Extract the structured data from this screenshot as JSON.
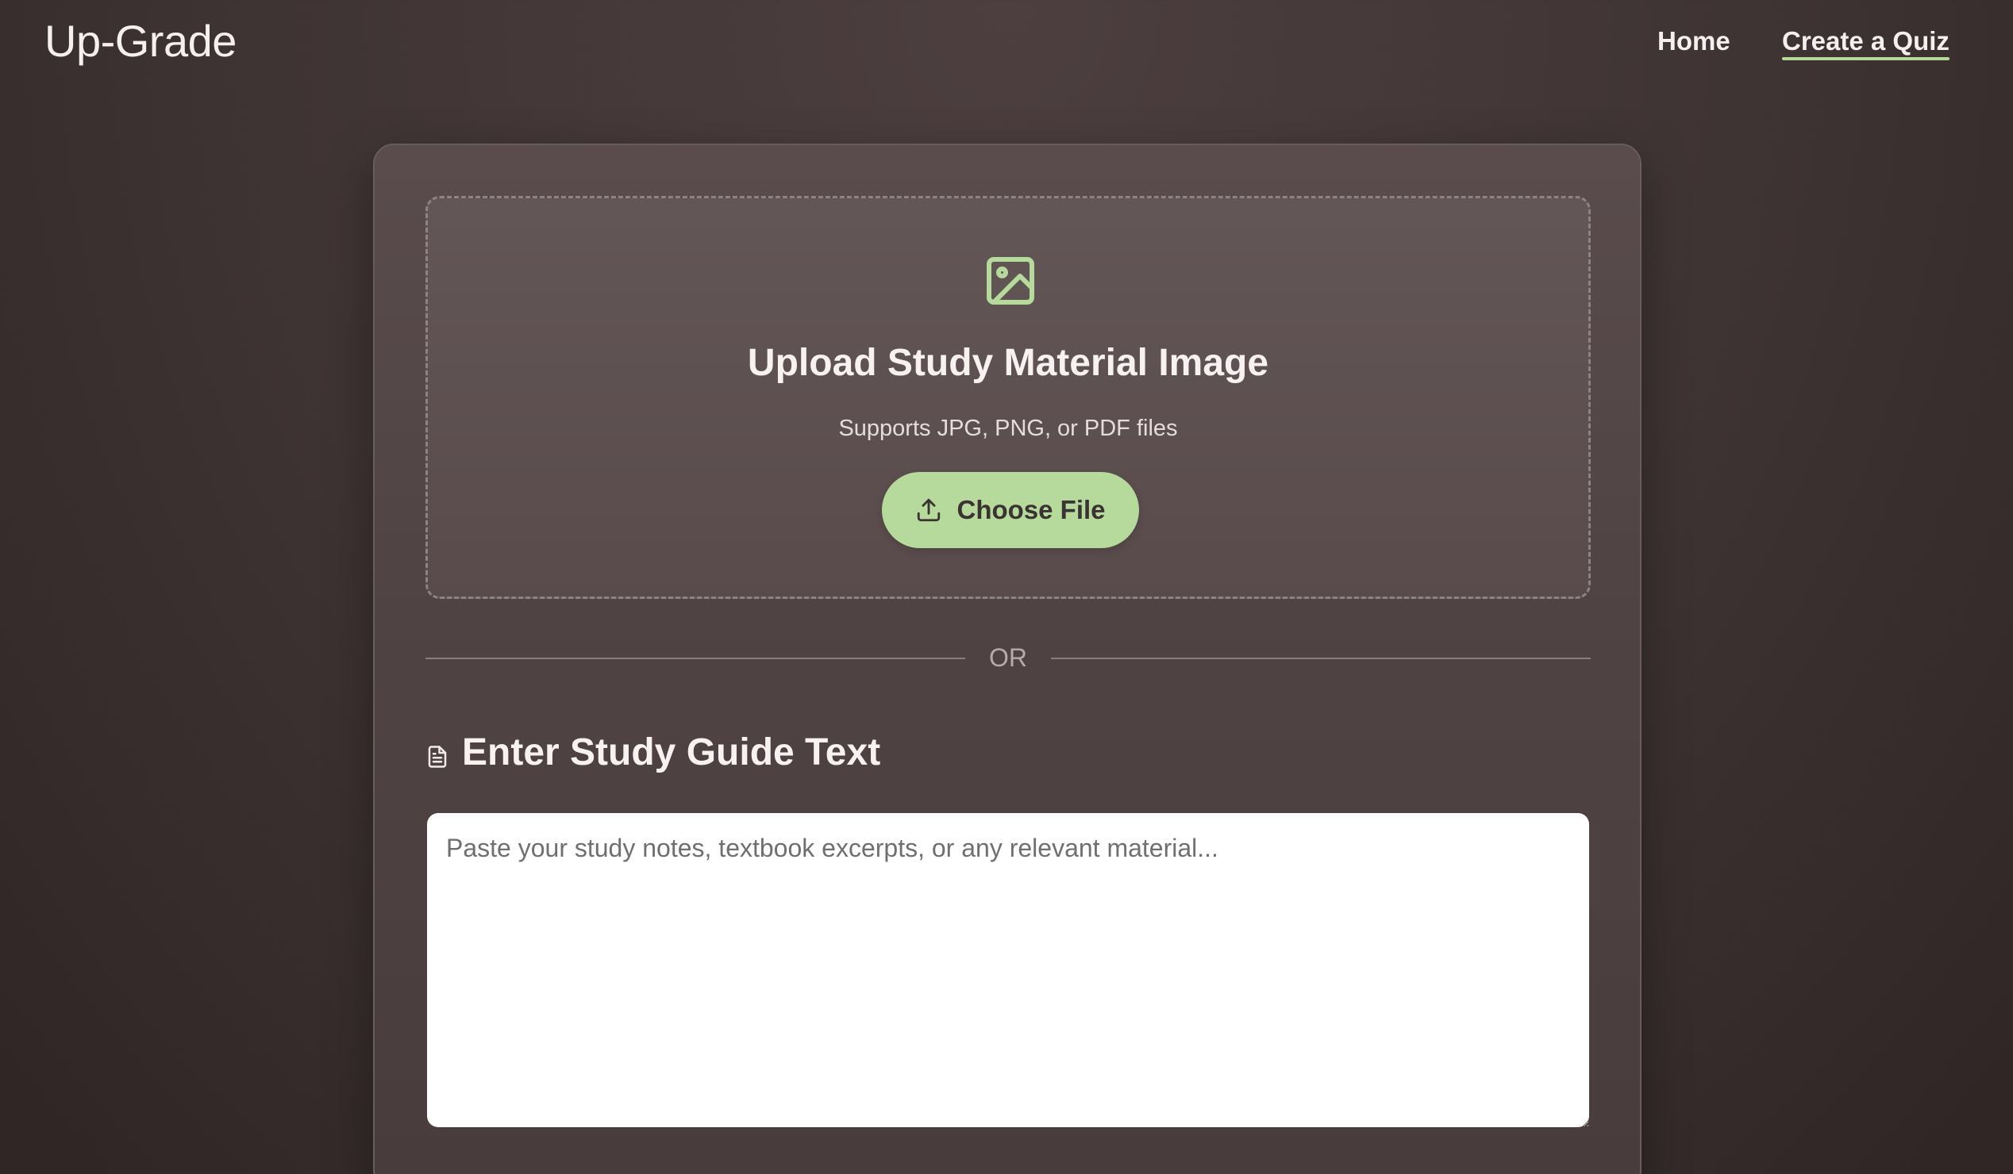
{
  "header": {
    "logo": "Up-Grade",
    "nav": {
      "home": "Home",
      "create_quiz": "Create a Quiz"
    }
  },
  "upload": {
    "icon": "image-icon",
    "title": "Upload Study Material Image",
    "subtitle": "Supports JPG, PNG, or PDF files",
    "button_label": "Choose File",
    "button_icon": "upload-icon"
  },
  "divider": {
    "label": "OR"
  },
  "study_guide": {
    "icon": "document-icon",
    "title": "Enter Study Guide Text",
    "placeholder": "Paste your study notes, textbook excerpts, or any relevant material...",
    "value": ""
  },
  "colors": {
    "accent": "#b5da9b",
    "background": "#3e3333",
    "card": "#544747",
    "text": "#f7f1f1"
  }
}
